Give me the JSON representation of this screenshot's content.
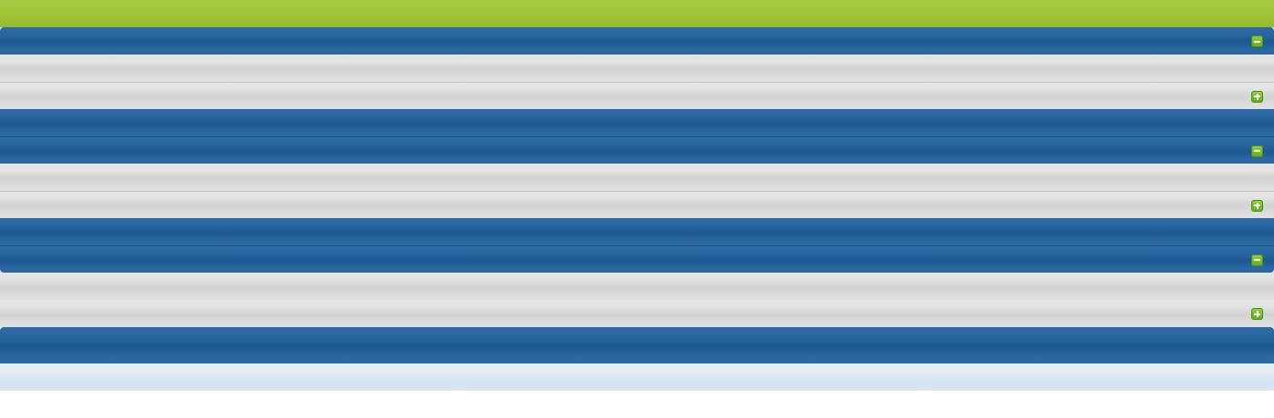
{
  "panels": [
    {
      "header_toggle": "minus-icon",
      "subrow_toggle": "plus-icon"
    },
    {
      "header_toggle": "minus-icon",
      "subrow_toggle": "plus-icon"
    },
    {
      "header_toggle": "minus-icon",
      "subrow_toggle": "plus-icon"
    }
  ],
  "colors": {
    "top_bar": "#a2c73c",
    "header_blue": "#2563a0",
    "row_gray": "#dedede",
    "footer_pale": "#e0ebf5",
    "toggle_green": "#6fbd24"
  }
}
